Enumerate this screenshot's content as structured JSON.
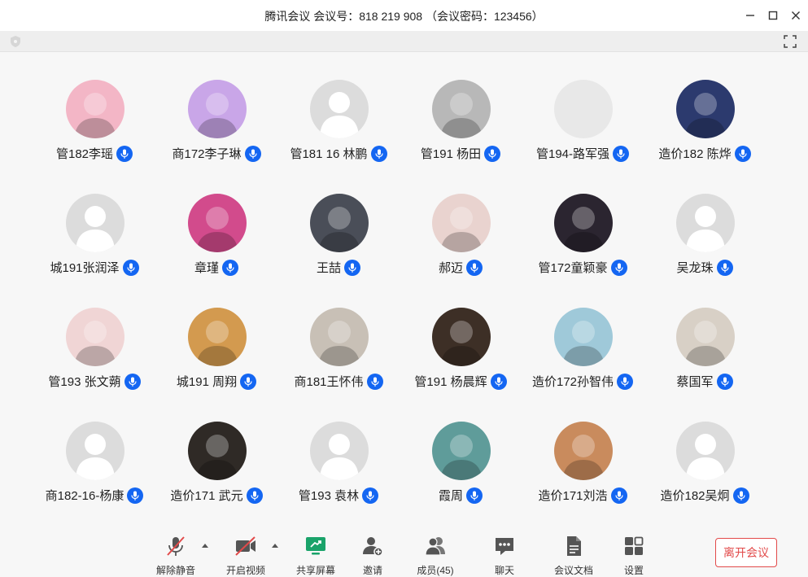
{
  "window": {
    "title": "腾讯会议 会议号：818 219 908 （会议密码：123456）"
  },
  "participants": [
    {
      "name": "管182李瑶",
      "avatar": "photo",
      "color": "#f3b6c6"
    },
    {
      "name": "商172李子琳",
      "avatar": "photo",
      "color": "#c9a6e8"
    },
    {
      "name": "管181 16 林鹏",
      "avatar": "default",
      "color": "#dcdcdc"
    },
    {
      "name": "管191 杨田",
      "avatar": "photo",
      "color": "#b8b8b8"
    },
    {
      "name": "管194-路军强",
      "avatar": "blank",
      "color": "#e6e6e6"
    },
    {
      "name": "造价182 陈烨",
      "avatar": "photo",
      "color": "#2c3a6e"
    },
    {
      "name": "城191张润泽",
      "avatar": "default",
      "color": "#dcdcdc"
    },
    {
      "name": "章瑾",
      "avatar": "photo",
      "color": "#d24b8c"
    },
    {
      "name": "王喆",
      "avatar": "photo",
      "color": "#4a4e58"
    },
    {
      "name": "郝迈",
      "avatar": "photo",
      "color": "#e9d3cf"
    },
    {
      "name": "管172童颖豪",
      "avatar": "photo",
      "color": "#2b2530"
    },
    {
      "name": "吴龙珠",
      "avatar": "default",
      "color": "#dcdcdc"
    },
    {
      "name": "管193 张文蒴",
      "avatar": "photo",
      "color": "#f0d5d5"
    },
    {
      "name": "城191 周翔",
      "avatar": "photo",
      "color": "#d39a4f"
    },
    {
      "name": "商181王怀伟",
      "avatar": "photo",
      "color": "#c8c0b6"
    },
    {
      "name": "管191 杨晨辉",
      "avatar": "photo",
      "color": "#3d2f26"
    },
    {
      "name": "造价172孙智伟",
      "avatar": "photo",
      "color": "#9fc9d9"
    },
    {
      "name": "蔡国军",
      "avatar": "photo",
      "color": "#d8d0c6"
    },
    {
      "name": "商182-16-杨康",
      "avatar": "default",
      "color": "#dcdcdc"
    },
    {
      "name": "造价171 武元",
      "avatar": "photo",
      "color": "#2f2a26"
    },
    {
      "name": "管193 袁林",
      "avatar": "default",
      "color": "#dcdcdc"
    },
    {
      "name": "霞周",
      "avatar": "photo",
      "color": "#5f9c9a"
    },
    {
      "name": "造价171刘浩",
      "avatar": "photo",
      "color": "#c98b5d"
    },
    {
      "name": "造价182吴炯",
      "avatar": "default",
      "color": "#dcdcdc"
    }
  ],
  "bottom_bar": {
    "unmute": "解除静音",
    "start_video": "开启视频",
    "share_screen": "共享屏幕",
    "invite": "邀请",
    "members": "成员(45)",
    "chat": "聊天",
    "docs": "会议文档",
    "settings": "设置",
    "leave": "离开会议"
  },
  "colors": {
    "accent": "#1466f2",
    "danger": "#e24a4a",
    "share_green": "#1aa36a"
  }
}
